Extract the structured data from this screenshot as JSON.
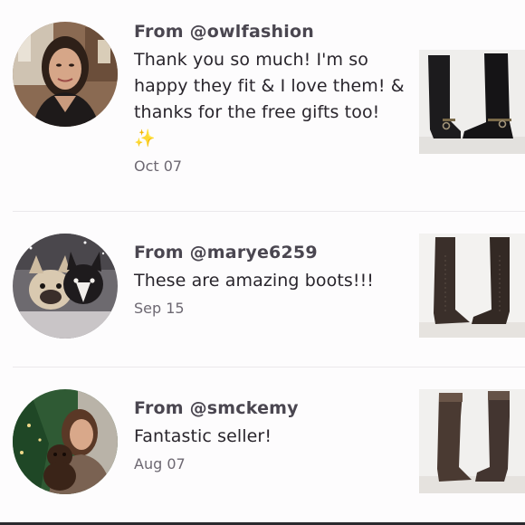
{
  "reviews": [
    {
      "author": "From @owlfashion",
      "message": "Thank you so much! I'm so happy they fit & I love them! & thanks for the free gifts too!",
      "emoji": "✨",
      "date": "Oct 07",
      "avatar_icon": "profile-photo-woman-dark-hair",
      "thumb_icon": "black-riding-boots-with-buckle"
    },
    {
      "author": "From @marye6259",
      "message": "These are amazing boots!!!",
      "date": "Sep 15",
      "avatar_icon": "profile-photo-french-bulldogs",
      "thumb_icon": "brown-lace-up-boots"
    },
    {
      "author": "From @smckemy",
      "message": "Fantastic seller!",
      "date": "Aug 07",
      "avatar_icon": "profile-photo-woman-with-dog",
      "thumb_icon": "brown-slouch-boots"
    }
  ],
  "colors": {
    "background": "#fdfcfd",
    "author_text": "#4a4650",
    "date_text": "#6d6872",
    "divider": "#ebe8ec"
  }
}
